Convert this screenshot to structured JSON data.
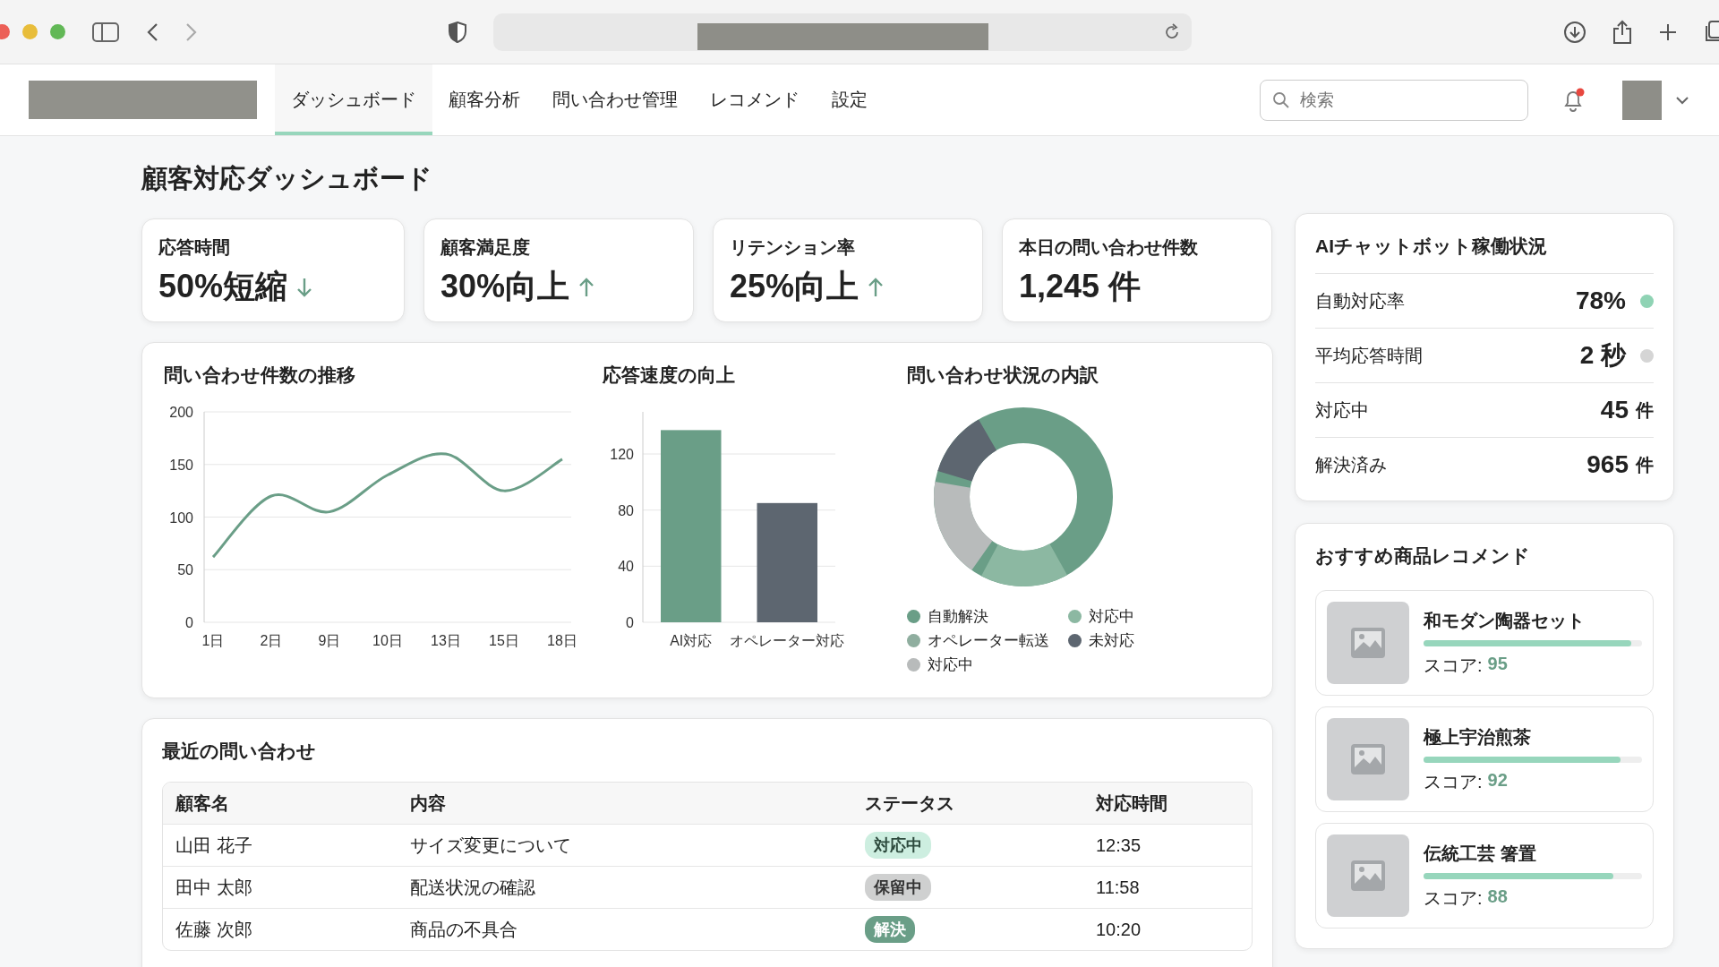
{
  "nav": {
    "tabs": [
      {
        "label": "ダッシュボード",
        "selected": true
      },
      {
        "label": "顧客分析",
        "selected": false
      },
      {
        "label": "問い合わせ管理",
        "selected": false
      },
      {
        "label": "レコメンド",
        "selected": false
      },
      {
        "label": "設定",
        "selected": false
      }
    ],
    "search": {
      "placeholder": "検索"
    },
    "notification": {
      "unread": true
    }
  },
  "page_title": "顧客対応ダッシュボード",
  "kpis": [
    {
      "label": "応答時間",
      "value": "50%短縮",
      "trend_up": false
    },
    {
      "label": "顧客満足度",
      "value": "30%向上",
      "trend_up": true
    },
    {
      "label": "リテンション率",
      "value": "25%向上",
      "trend_up": true
    },
    {
      "label": "本日の問い合わせ件数",
      "value": "1,245 件"
    }
  ],
  "line_chart": {
    "title": "問い合わせ件数の推移",
    "chart_data": {
      "type": "line",
      "grid": true,
      "categories": [
        "1日",
        "2日",
        "9日",
        "10日",
        "13日",
        "15日",
        "18日"
      ],
      "yticks": [
        0,
        50,
        100,
        150,
        200
      ],
      "ylim": [
        0,
        200
      ],
      "series": [
        {
          "color": "#6a9e87",
          "values": [
            62,
            120,
            105,
            140,
            160,
            125,
            155
          ]
        }
      ]
    }
  },
  "bar_chart": {
    "title": "応答速度の向上",
    "chart_data": {
      "type": "bar",
      "grid": true,
      "categories": [
        "AI対応",
        "オペレーター対応"
      ],
      "yticks": [
        0,
        40,
        80,
        120
      ],
      "ylim": [
        0,
        150
      ],
      "series": [
        {
          "values": [
            137,
            85
          ]
        }
      ],
      "colors": [
        "#6a9e87",
        "#5d6670"
      ]
    }
  },
  "donut": {
    "title": "問い合わせ状況の内訳",
    "legend": [
      {
        "label": "自動解決",
        "color": "#6a9e87"
      },
      {
        "label": "対応中",
        "color": "#8cb8a2"
      },
      {
        "label": "オペレーター転送",
        "color": "#8fae9f"
      },
      {
        "label": "未対応",
        "color": "#5d6670"
      },
      {
        "label": "対応中",
        "color": "#b8bbbb"
      }
    ]
  },
  "bot_status": {
    "title": "AIチャットボット稼働状況",
    "rows": [
      {
        "label": "自動対応率",
        "value": "78%",
        "color": "#8fd3b4"
      },
      {
        "label": "平均応答時間",
        "value": "2 秒",
        "color": "#d5d5d5"
      },
      {
        "label": "対応中",
        "value": "45",
        "unit": "件"
      },
      {
        "label": "解決済み",
        "value": "965",
        "unit": "件"
      }
    ]
  },
  "recommend": {
    "title": "おすすめ商品レコメンド",
    "items": [
      {
        "name": "和モダン陶器セット",
        "score_label": "スコア:",
        "score": "95",
        "level": 0.95
      },
      {
        "name": "極上宇治煎茶",
        "score_label": "スコア:",
        "score": "92",
        "level": 0.9
      },
      {
        "name": "伝統工芸 箸置",
        "score_label": "スコア:",
        "score": "88",
        "level": 0.87
      }
    ]
  },
  "inquiries": {
    "title": "最近の問い合わせ",
    "columns": [
      "顧客名",
      "内容",
      "ステータス",
      "対応時間"
    ],
    "rows": [
      {
        "name": "山田 花子",
        "content": "サイズ変更について",
        "status": {
          "text": "対応中",
          "kind": "in_progress"
        },
        "time": "12:35"
      },
      {
        "name": "田中 太郎",
        "content": "配送状況の確認",
        "status": {
          "text": "保留中",
          "kind": "on_hold"
        },
        "time": "11:58"
      },
      {
        "name": "佐藤 次郎",
        "content": "商品の不具合",
        "status": {
          "text": "解決",
          "kind": "resolved"
        },
        "time": "10:20"
      }
    ]
  }
}
